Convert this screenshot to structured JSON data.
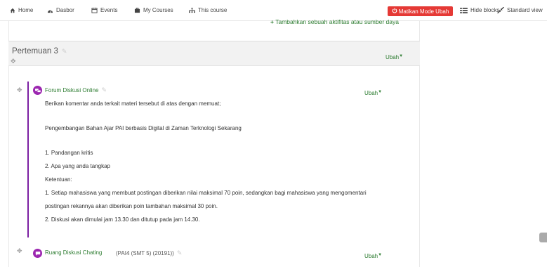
{
  "nav": {
    "home": "Home",
    "dashboard": "Dasbor",
    "events": "Events",
    "my_courses": "My Courses",
    "this_course": "This course",
    "edit_mode": "Matikan Mode Ubah",
    "hide_blocks": "Hide blocks",
    "standard_view": "Standard view"
  },
  "add_activity": "Tambahkan sebuah aktifitas atau sumber daya",
  "section": {
    "title": "Pertemuan 3",
    "edit": "Ubah"
  },
  "forum": {
    "title": "Forum Diskusi Online",
    "edit": "Ubah",
    "lines": [
      "Berikan komentar anda terkait materi tersebut di atas dengan memuat;",
      "Pengembangan Bahan Ajar PAI berbasis Digital di Zaman Terknologi Sekarang",
      "1.  Pandangan kritis",
      "2.  Apa yang anda tangkap",
      "Ketentuan:",
      "1. Setiap mahasiswa yang membuat postingan diberikan nilai maksimal 70 poin, sedangkan bagi mahasiswa yang mengomentari",
      "postingan rekannya akan diberikan poin tambahan maksimal 30 poin.",
      "2. Diskusi akan dimulai jam 13.30 dan ditutup pada jam 14.30."
    ]
  },
  "chat": {
    "title": "Ruang Diskusi Chating",
    "group": "(PAI4 (SMT 5) (20191))",
    "edit": "Ubah"
  },
  "colors": {
    "accent_green": "#2e7d32",
    "edit_red": "#e53935",
    "activity_purple": "#9c27b0"
  }
}
